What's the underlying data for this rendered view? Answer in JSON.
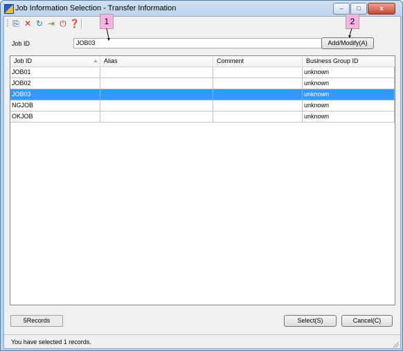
{
  "window": {
    "title": "Job Information Selection - Transfer Information",
    "controls": {
      "minimize": "–",
      "maximize": "□",
      "close": "x"
    }
  },
  "toolbar": {
    "icons": [
      {
        "name": "copy-icon",
        "glyph": "⎘",
        "color": "#1f4fa8"
      },
      {
        "name": "delete-icon",
        "glyph": "✕",
        "color": "#d62020"
      },
      {
        "name": "refresh-icon",
        "glyph": "↻",
        "color": "#1a7ab8"
      },
      {
        "name": "export-icon",
        "glyph": "⇥",
        "color": "#6b8a1a"
      },
      {
        "name": "power-icon",
        "glyph": "⏻",
        "color": "#c0282a"
      },
      {
        "name": "help-icon",
        "glyph": "❓",
        "color": "#1b4fb0"
      }
    ]
  },
  "form": {
    "job_id_label": "Job ID",
    "job_id_value": "JOB03",
    "add_modify_label": "Add/Modify(A)"
  },
  "table": {
    "columns": [
      "Job ID",
      "Alias",
      "Comment",
      "Business Group ID"
    ],
    "rows": [
      {
        "job_id": "JOB01",
        "alias": "",
        "comment": "",
        "business_group_id": "unknown",
        "selected": false
      },
      {
        "job_id": "JOB02",
        "alias": "",
        "comment": "",
        "business_group_id": "unknown",
        "selected": false
      },
      {
        "job_id": "JOB03",
        "alias": "",
        "comment": "",
        "business_group_id": "unknown",
        "selected": true
      },
      {
        "job_id": "NGJOB",
        "alias": "",
        "comment": "",
        "business_group_id": "unknown",
        "selected": false
      },
      {
        "job_id": "OKJOB",
        "alias": "",
        "comment": "",
        "business_group_id": "unknown",
        "selected": false
      }
    ]
  },
  "footer": {
    "records": "5Records",
    "select_label": "Select(S)",
    "cancel_label": "Cancel(C)"
  },
  "status": {
    "message": "You have selected 1 records."
  },
  "callouts": [
    "1",
    "2"
  ],
  "colors": {
    "selection": "#3399ff",
    "callout": "#f7b2e6"
  }
}
